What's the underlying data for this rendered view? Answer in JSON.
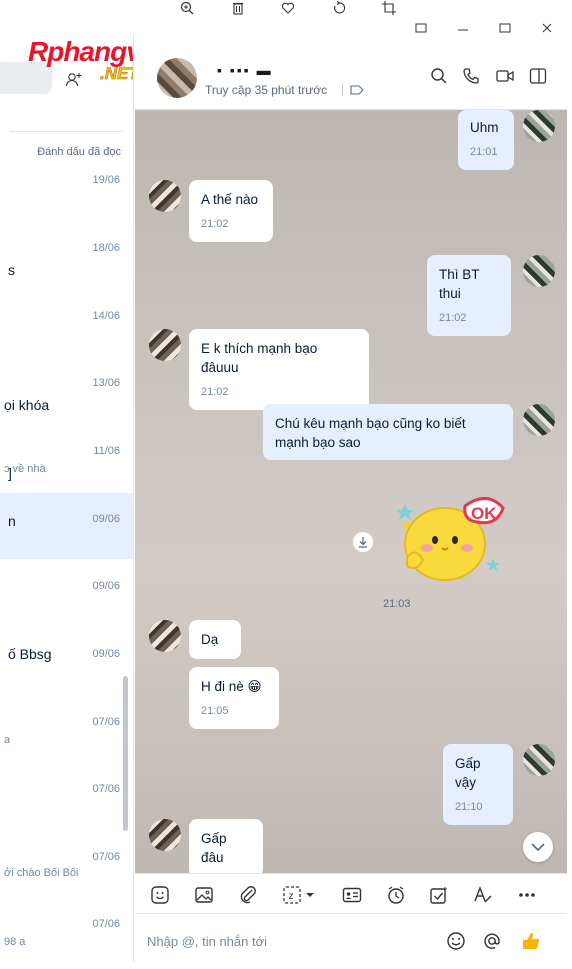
{
  "viewer_toolbar": {
    "icons": [
      "zoom-in-icon",
      "trash-icon",
      "heart-icon",
      "rotate-icon",
      "crop-icon"
    ]
  },
  "sidebar": {
    "logo_text": "Rphangvn",
    "logo_sub": ".NET",
    "mark_read": "Đánh dấu đã đọc",
    "conversations": [
      {
        "date": "19/06",
        "fragment": "",
        "sub": ""
      },
      {
        "date": "18/06",
        "fragment": "s",
        "sub": ""
      },
      {
        "date": "14/06",
        "fragment": "",
        "sub": ""
      },
      {
        "date": "13/06",
        "fragment": "ọi khóa",
        "sub": ""
      },
      {
        "date": "11/06",
        "fragment": "]",
        "sub": "ɔ về nhà"
      },
      {
        "date": "09/06",
        "fragment": "n",
        "sub": "",
        "active": true
      },
      {
        "date": "09/06",
        "fragment": "",
        "sub": ""
      },
      {
        "date": "09/06",
        "fragment": "ố Bbsg",
        "sub": ""
      },
      {
        "date": "07/06",
        "fragment": "a",
        "sub": ""
      },
      {
        "date": "07/06",
        "fragment": "",
        "sub": ""
      },
      {
        "date": "07/06",
        "fragment": "",
        "sub": "ởi chào Bối Bối"
      },
      {
        "date": "07/06",
        "fragment": "98 ạ",
        "sub": ""
      }
    ]
  },
  "chat_header": {
    "name": "▪ ▪▪▪ ▬",
    "status": "Truy cập 35 phút trước",
    "icons": [
      "search-icon",
      "phone-icon",
      "video-call-icon",
      "sidebar-toggle-icon"
    ]
  },
  "messages": [
    {
      "side": "out",
      "text": "Uhm",
      "time": "21:01"
    },
    {
      "side": "in",
      "text": "A thế nào",
      "time": "21:02"
    },
    {
      "side": "out",
      "text": "Thì BT thui",
      "time": "21:02"
    },
    {
      "side": "in",
      "text": "E k thích mạnh bạo đâuuu",
      "time": "21:02"
    },
    {
      "side": "out",
      "text": "Chú kêu mạnh bạo cũng ko biết mạnh bạo sao",
      "time": ""
    },
    {
      "side": "out",
      "sticker": "ok-sticker",
      "time": "21:03"
    },
    {
      "side": "in",
      "text": "Dạ",
      "time": ""
    },
    {
      "side": "in",
      "text": "H đi nè 😁",
      "time": "21:05"
    },
    {
      "side": "out",
      "text": "Gấp vậy",
      "time": "21:10"
    },
    {
      "side": "in",
      "text": "Gấp đâu",
      "time": ""
    }
  ],
  "sticker_text": "OK",
  "composer": {
    "placeholder": "Nhập @, tin nhắn tới",
    "toolbar_icons": [
      "sticker-icon",
      "image-icon",
      "attachment-icon",
      "screenshot-icon",
      "contact-card-icon",
      "reminder-icon",
      "task-icon",
      "format-text-icon",
      "more-icon"
    ],
    "input_icons": [
      "emoji-icon",
      "mention-icon",
      "thumbs-up-icon"
    ]
  },
  "colors": {
    "accent": "#0068ff",
    "outgoing_bubble": "#e5efff",
    "incoming_bubble": "#ffffff",
    "active_conversation": "#e5efff"
  }
}
